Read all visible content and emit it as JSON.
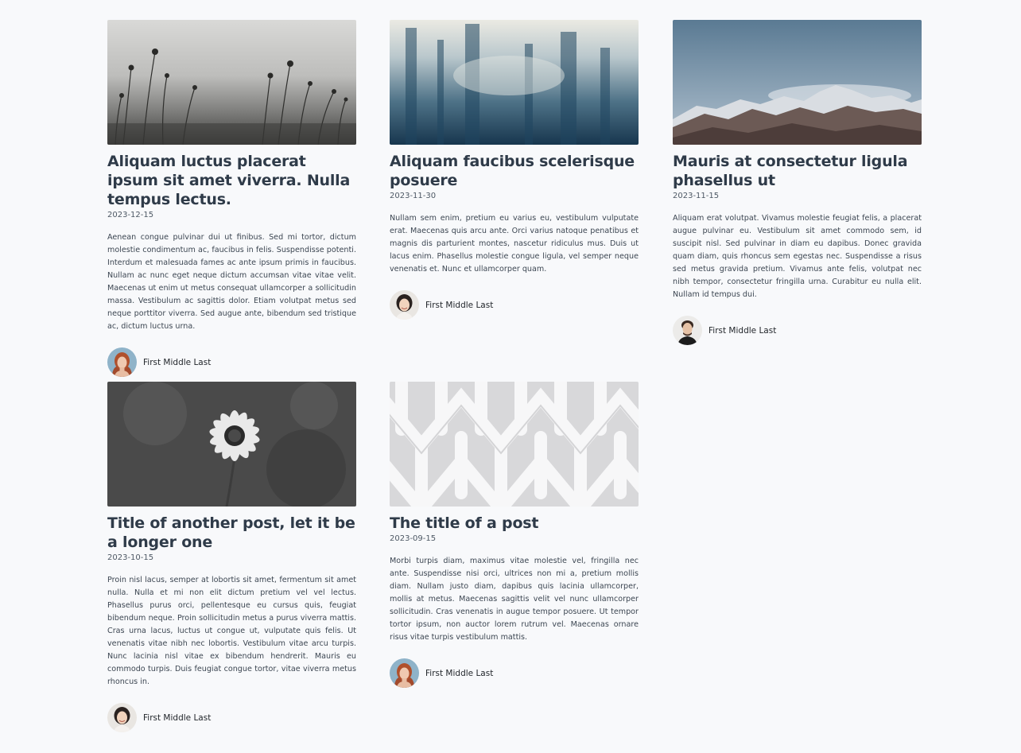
{
  "posts": [
    {
      "title": "Aliquam luctus placerat ipsum sit amet viverra. Nulla tempus lectus.",
      "date": "2023-12-15",
      "excerpt": "Aenean congue pulvinar dui ut finibus. Sed mi tortor, dictum molestie condimentum ac, faucibus in felis. Suspendisse potenti. Interdum et malesuada fames ac ante ipsum primis in faucibus. Nullam ac nunc eget neque dictum accumsan vitae vitae velit. Maecenas ut enim ut metus consequat ullamcorper a sollicitudin massa. Vestibulum ac sagittis dolor. Etiam volutpat metus sed neque porttitor viverra. Sed augue ante, bibendum sed tristique ac, dictum luctus urna.",
      "author": "First Middle Last",
      "image": "dandelion-field-photo",
      "avatar": "redhead-woman-avatar"
    },
    {
      "title": "Aliquam faucibus scelerisque posuere",
      "date": "2023-11-30",
      "excerpt": "Nullam sem enim, pretium eu varius eu, vestibulum vulputate erat. Maecenas quis arcu ante. Orci varius natoque penatibus et magnis dis parturient montes, nascetur ridiculus mus. Duis ut lacus enim. Phasellus molestie congue ligula, vel semper neque venenatis et. Nunc et ullamcorper quam.",
      "author": "First Middle Last",
      "image": "blue-mist-photo",
      "avatar": "smiling-woman-avatar"
    },
    {
      "title": "Mauris at consectetur ligula phasellus ut",
      "date": "2023-11-15",
      "excerpt": "Aliquam erat volutpat. Vivamus molestie feugiat felis, a placerat augue pulvinar eu. Vestibulum sit amet commodo sem, id suscipit nisl. Sed pulvinar in diam eu dapibus. Donec gravida quam diam, quis rhoncus sem egestas nec. Suspendisse a risus sed metus gravida pretium. Vivamus ante felis, volutpat nec nibh tempor, consectetur fringilla urna. Curabitur eu nulla elit. Nullam id tempus dui.",
      "author": "First Middle Last",
      "image": "mountain-range-photo",
      "avatar": "man-avatar"
    },
    {
      "title": "Title of another post, let it be a longer one",
      "date": "2023-10-15",
      "excerpt": "Proin nisl lacus, semper at lobortis sit amet, fermentum sit amet nulla. Nulla et mi non elit dictum pretium vel vel lectus. Phasellus purus orci, pellentesque eu cursus quis, feugiat bibendum neque. Proin sollicitudin metus a purus viverra mattis. Cras urna lacus, luctus ut congue ut, vulputate quis felis. Ut venenatis vitae nibh nec lobortis. Vestibulum vitae arcu turpis. Nunc lacinia nisl vitae ex bibendum hendrerit. Mauris eu commodo turpis. Duis feugiat congue tortor, vitae viverra metus rhoncus in.",
      "author": "First Middle Last",
      "image": "daisy-flower-photo",
      "avatar": "smiling-woman-avatar"
    },
    {
      "title": "The title of a post",
      "date": "2023-09-15",
      "excerpt": "Morbi turpis diam, maximus vitae molestie vel, fringilla nec ante. Suspendisse nisi orci, ultrices non mi a, pretium mollis diam. Nullam justo diam, dapibus quis lacinia ullamcorper, mollis at metus. Maecenas sagittis velit vel nunc ullamcorper sollicitudin. Cras venenatis in augue tempor posuere. Ut tempor tortor ipsum, non auctor lorem rutrum vel. Maecenas ornare risus vitae turpis vestibulum mattis.",
      "author": "First Middle Last",
      "image": "white-weave-pattern-photo",
      "avatar": "redhead-woman-avatar"
    }
  ]
}
